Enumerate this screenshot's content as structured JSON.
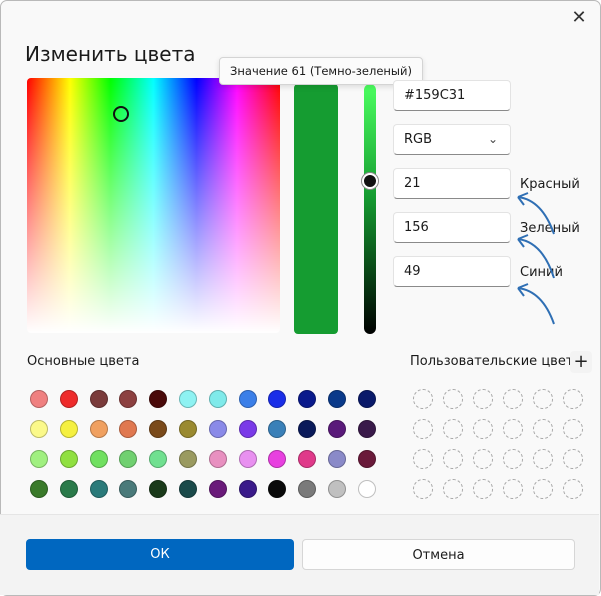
{
  "dialog": {
    "title": "Изменить цвета",
    "close_icon": "close-icon"
  },
  "tooltip": "Значение 61 (Темно-зеленый)",
  "current_color": "#159C31",
  "fields": {
    "hex_value": "#159C31",
    "mode_value": "RGB",
    "red_value": "21",
    "green_value": "156",
    "blue_value": "49",
    "red_label": "Красный",
    "green_label": "Зеленый",
    "blue_label": "Синий"
  },
  "basic_colors_label": "Основные цвета",
  "custom_colors_label": "Пользовательские цвета",
  "add_custom_icon": "plus-icon",
  "basic_colors": [
    [
      "#ef8080",
      "#ee2b2b",
      "#7a3b3b",
      "#8c4040",
      "#4a0a0a",
      "#8ef2f2",
      "#7feaea",
      "#3b7fe8",
      "#1a2ee8",
      "#0a1a8c",
      "#0a3a8a",
      "#0a1a6a"
    ],
    [
      "#fbf98a",
      "#f5f040",
      "#f0a060",
      "#e07850",
      "#7a4a1a",
      "#9a8a30",
      "#8a8ae8",
      "#7a3ae8",
      "#3a80b8",
      "#0a1a5a",
      "#5a1a7a",
      "#3a1a4a"
    ],
    [
      "#a0f080",
      "#90e040",
      "#70e060",
      "#70d070",
      "#70e090",
      "#9a9a60",
      "#e890c0",
      "#e890f0",
      "#e840e0",
      "#e03a8a",
      "#8a8ac8",
      "#6a1a3a"
    ],
    [
      "#3a7a2a",
      "#2a7a4a",
      "#2a7a7a",
      "#4a7a7a",
      "#1a3a1a",
      "#1a4a4a",
      "#6a1a7a",
      "#3a1a8a",
      "#0a0a0a",
      "#7a7a7a",
      "#c0c0c0",
      "#ffffff"
    ]
  ],
  "buttons": {
    "ok": "ОК",
    "cancel": "Отмена"
  }
}
